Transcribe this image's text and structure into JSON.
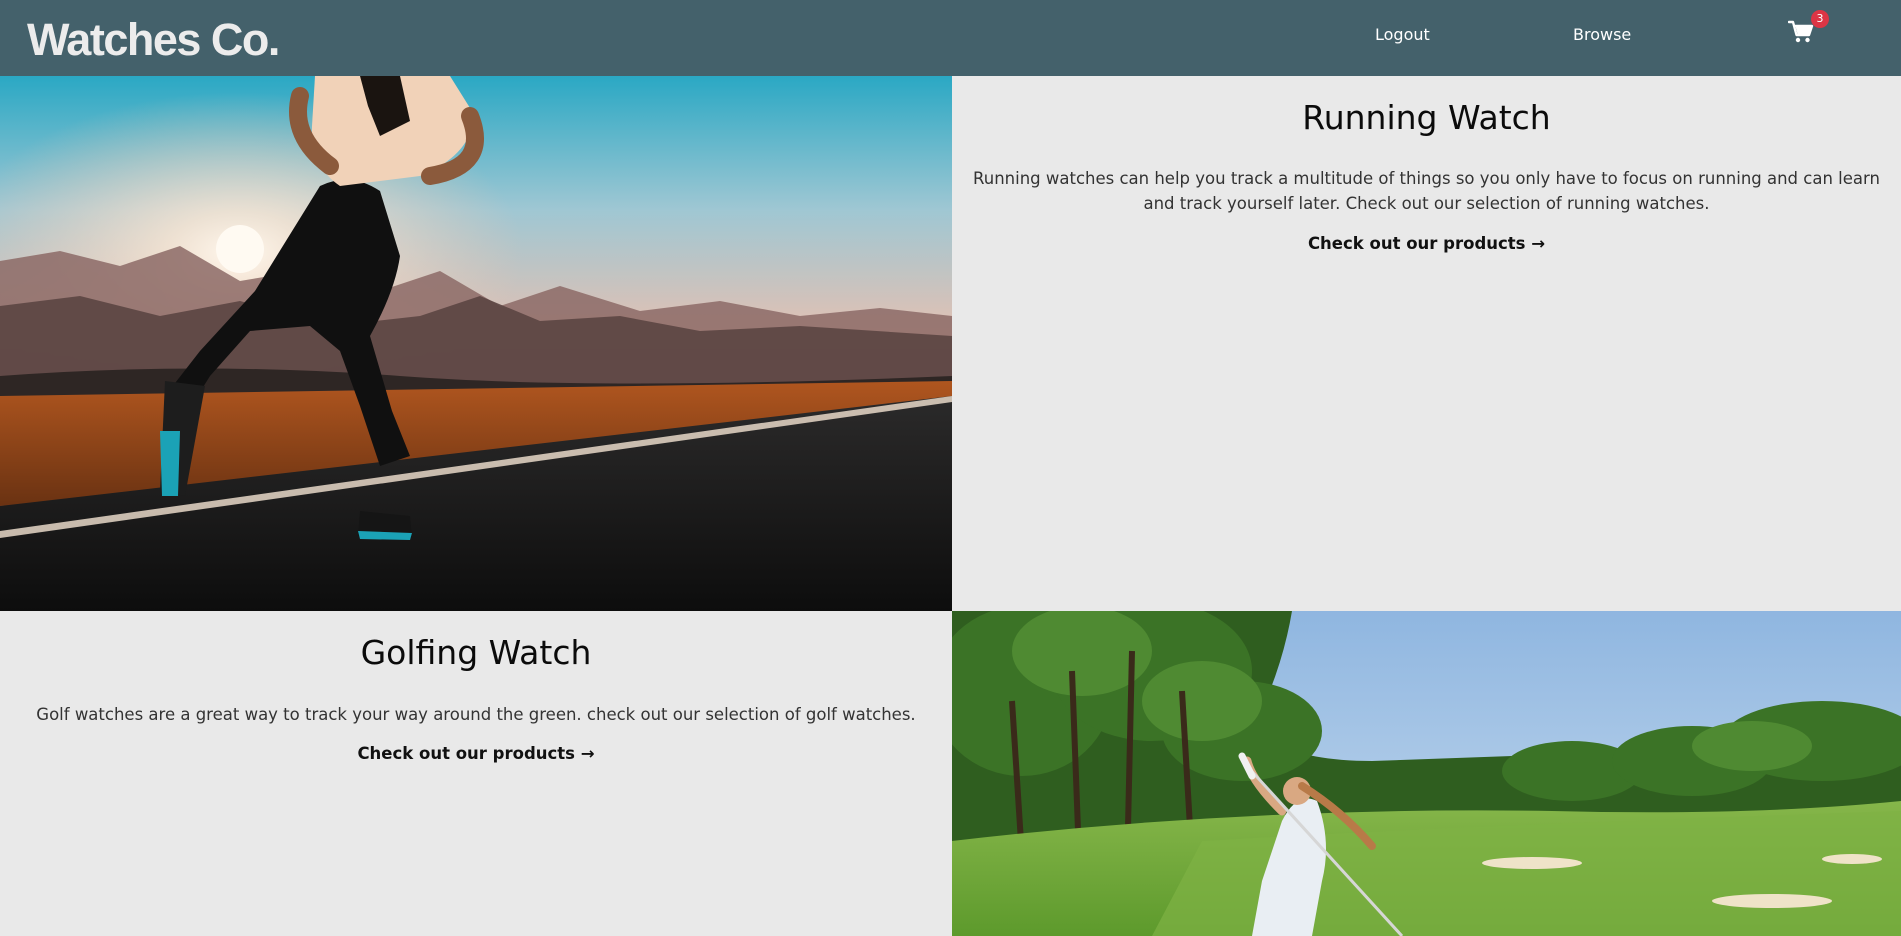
{
  "navbar": {
    "brand": "Watches Co.",
    "links": [
      {
        "label": "Logout"
      },
      {
        "label": "Browse"
      }
    ],
    "cart": {
      "icon": "shopping-cart-icon",
      "count": "3"
    },
    "colors": {
      "background": "#44616b",
      "badge": "#dc3545"
    }
  },
  "sections": {
    "running": {
      "title": "Running Watch",
      "description": "Running watches can help you track a multitude of things so you only have to focus on running and can learn and track yourself later. Check out our selection of running watches.",
      "link": "Check out our products →",
      "image": "runner-at-sunset-photo"
    },
    "golf": {
      "title": "Golfing Watch",
      "description": "Golf watches are a great way to track your way around the green. check out our selection of golf watches.",
      "link": "Check out our products →",
      "image": "golfer-swinging-photo"
    }
  }
}
